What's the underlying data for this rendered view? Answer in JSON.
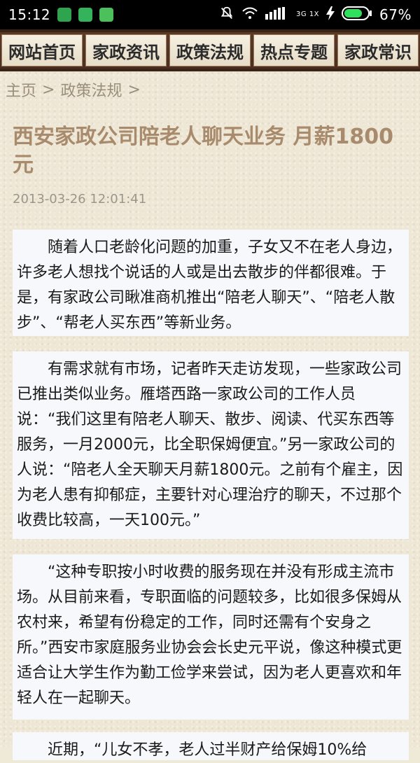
{
  "status_bar": {
    "time": "15:12",
    "network": "3G 1X",
    "battery_percent": "67%",
    "icons": [
      "shield-app-icon",
      "android-app-icon",
      "cat-app-icon",
      "mute-icon",
      "wifi-icon",
      "signal-icon",
      "charging-icon",
      "battery-icon"
    ]
  },
  "nav": {
    "items": [
      {
        "label": "网站首页"
      },
      {
        "label": "家政资讯"
      },
      {
        "label": "政策法规"
      },
      {
        "label": "热点专题"
      },
      {
        "label": "家政常识"
      }
    ]
  },
  "breadcrumb": {
    "home": "主页",
    "sep": ">",
    "current": "政策法规"
  },
  "article": {
    "title": "西安家政公司陪老人聊天业务 月薪1800元",
    "date": "2013-03-26 12:01:41",
    "paragraphs": [
      "随着人口老龄化问题的加重，子女又不在老人身边，许多老人想找个说话的人或是出去散步的伴都很难。于是，有家政公司瞅准商机推出“陪老人聊天”、“陪老人散步”、“帮老人买东西”等新业务。",
      "有需求就有市场，记者昨天走访发现，一些家政公司已推出类似业务。雁塔西路一家政公司的工作人员说：“我们这里有陪老人聊天、散步、阅读、代买东西等服务，一月2000元，比全职保姆便宜。”另一家政公司的人说：“陪老人全天聊天月薪1800元。之前有个雇主，因为老人患有抑郁症，主要针对心理治疗的聊天，不过那个收费比较高，一天100元。”",
      "“这种专职按小时收费的服务现在并没有形成主流市场。从目前来看，专职面临的问题较多，比如很多保姆从农村来，希望有份稳定的工作，同时还需有个安身之所。”西安市家庭服务业协会会长史元平说，像这种模式更适合让大学生作为勤工俭学来尝试，因为老人更喜欢和年轻人在一起聊天。",
      "近期，“儿女不孝，老人过半财产给保姆10%给"
    ]
  },
  "colors": {
    "nav_bar": "#4a2e1f",
    "title": "#a88a6c",
    "paragraph_bg": "#f6f8fb"
  }
}
